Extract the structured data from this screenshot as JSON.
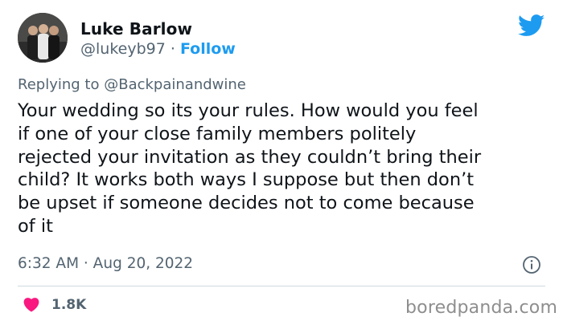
{
  "author": {
    "display_name": "Luke Barlow",
    "handle": "@lukeyb97",
    "separator": "·",
    "follow_label": "Follow"
  },
  "reply": {
    "prefix": "Replying to",
    "mention": "@Backpainandwine"
  },
  "tweet": {
    "text": "Your wedding so its your rules. How would you feel\nif one of your close family members politely\nrejected your invitation as they couldn’t bring their\nchild? It works both ways I suppose but then don’t\nbe upset if someone decides not to come because\nof it",
    "timestamp": "6:32 AM · Aug 20, 2022"
  },
  "engagement": {
    "likes": "1.8K"
  },
  "watermark": "boredpanda.com",
  "colors": {
    "twitter_blue": "#1d9bf0",
    "like_pink": "#f91880",
    "muted_text": "#536471"
  },
  "icons": {
    "logo": "twitter-bird-icon",
    "info": "info-icon",
    "like": "heart-icon"
  }
}
